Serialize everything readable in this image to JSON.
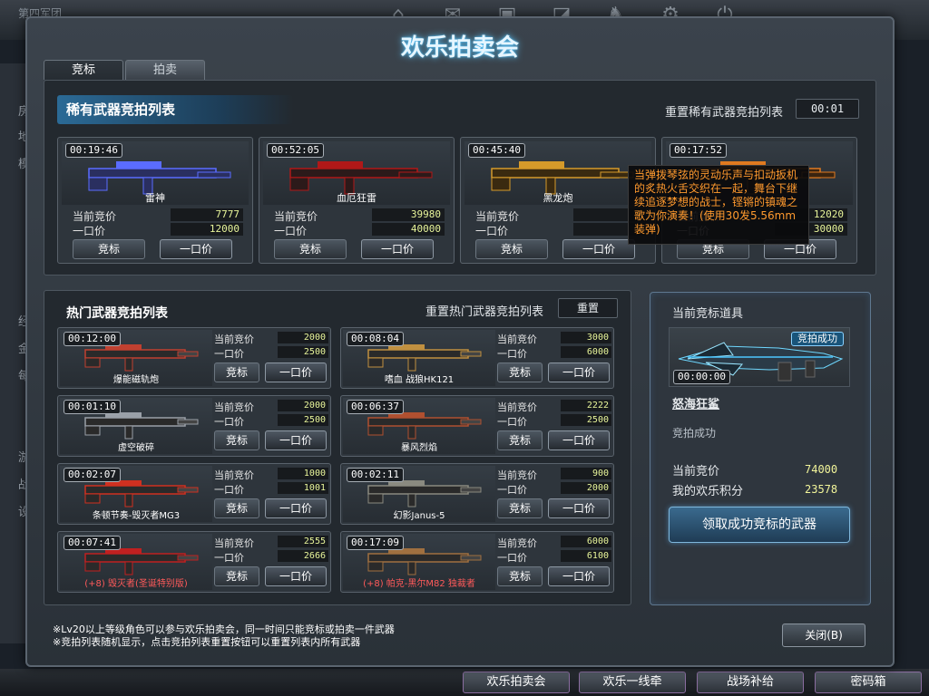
{
  "background": {
    "title": "第四军团",
    "nav_labels": [
      "公告",
      "战绩",
      "商城",
      "仓库",
      "战队",
      "设置",
      "退出"
    ],
    "side_labels": [
      "房间",
      "地图",
      "模式",
      "经验",
      "金币",
      "每日",
      "游戏",
      "战场",
      "设置"
    ]
  },
  "dialog": {
    "title": "欢乐拍卖会",
    "tabs": [
      {
        "label": "竞标",
        "active": true
      },
      {
        "label": "拍卖",
        "active": false
      }
    ]
  },
  "rare": {
    "section_title": "稀有武器竞拍列表",
    "reset_label": "重置稀有武器竞拍列表",
    "reset_timer": "00:01",
    "price_labels": {
      "current": "当前竞价",
      "buyout": "一口价"
    },
    "bid_label": "竞标",
    "buyout_btn_label": "一口价",
    "items": [
      {
        "timer": "00:19:46",
        "name": "雷神",
        "current": "7777",
        "buyout": "12000"
      },
      {
        "timer": "00:52:05",
        "name": "血厄狂雷",
        "current": "39980",
        "buyout": "40000"
      },
      {
        "timer": "00:45:40",
        "name": "黑龙炮",
        "current": "6",
        "buyout": "9"
      },
      {
        "timer": "00:17:52",
        "name": "",
        "current": "12020",
        "buyout": "30000"
      }
    ]
  },
  "hot": {
    "section_title": "热门武器竞拍列表",
    "reset_label": "重置热门武器竞拍列表",
    "reset_btn": "重置",
    "items": [
      {
        "timer": "00:12:00",
        "name": "爆能磁轨炮",
        "current": "2000",
        "buyout": "2500",
        "red": false
      },
      {
        "timer": "00:08:04",
        "name": "嗜血 战狼HK121",
        "current": "3000",
        "buyout": "6000",
        "red": false
      },
      {
        "timer": "00:01:10",
        "name": "虚空破碎",
        "current": "2000",
        "buyout": "2500",
        "red": false
      },
      {
        "timer": "00:06:37",
        "name": "暴风烈焰",
        "current": "2222",
        "buyout": "2500",
        "red": false
      },
      {
        "timer": "00:02:07",
        "name": "条顿节奏-毁灭者MG3",
        "current": "1000",
        "buyout": "1001",
        "red": false
      },
      {
        "timer": "00:02:11",
        "name": "幻影Janus-5",
        "current": "900",
        "buyout": "2000",
        "red": false
      },
      {
        "timer": "00:07:41",
        "name": "(+8) 毁灭者(圣诞特别版)",
        "current": "2555",
        "buyout": "2666",
        "red": true
      },
      {
        "timer": "00:17:09",
        "name": "(+8) 帕克-黑尔M82 独裁者",
        "current": "6000",
        "buyout": "6100",
        "red": true
      }
    ]
  },
  "current_item": {
    "title": "当前竞标道具",
    "badge": "竞拍成功",
    "timer": "00:00:00",
    "name": "怒海狂鲨",
    "status": "竞拍成功",
    "current_label": "当前竞价",
    "current_value": "74000",
    "points_label": "我的欢乐积分",
    "points_value": "23578",
    "claim_btn": "领取成功竞标的武器"
  },
  "tooltip": "当弹拨琴弦的灵动乐声与扣动扳机的炙热火舌交织在一起，舞台下继续追逐梦想的战士，铿锵的镇魂之歌为你演奏！(使用30发5.56mm装弹)",
  "notes": [
    "※Lv20以上等级角色可以参与欢乐拍卖会，同一时间只能竞标或拍卖一件武器",
    "※竞拍列表随机显示，点击竞拍列表重置按钮可以重置列表内所有武器"
  ],
  "close_btn": "关闭(B)",
  "bottom_buttons": [
    "欢乐拍卖会",
    "欢乐一线牵",
    "战场补给",
    "密码箱"
  ],
  "colors": {
    "accent": "#5ac8ff",
    "price": "#e8f59a",
    "tooltip": "#ff9a2e",
    "red_name": "#ff5a5a"
  }
}
